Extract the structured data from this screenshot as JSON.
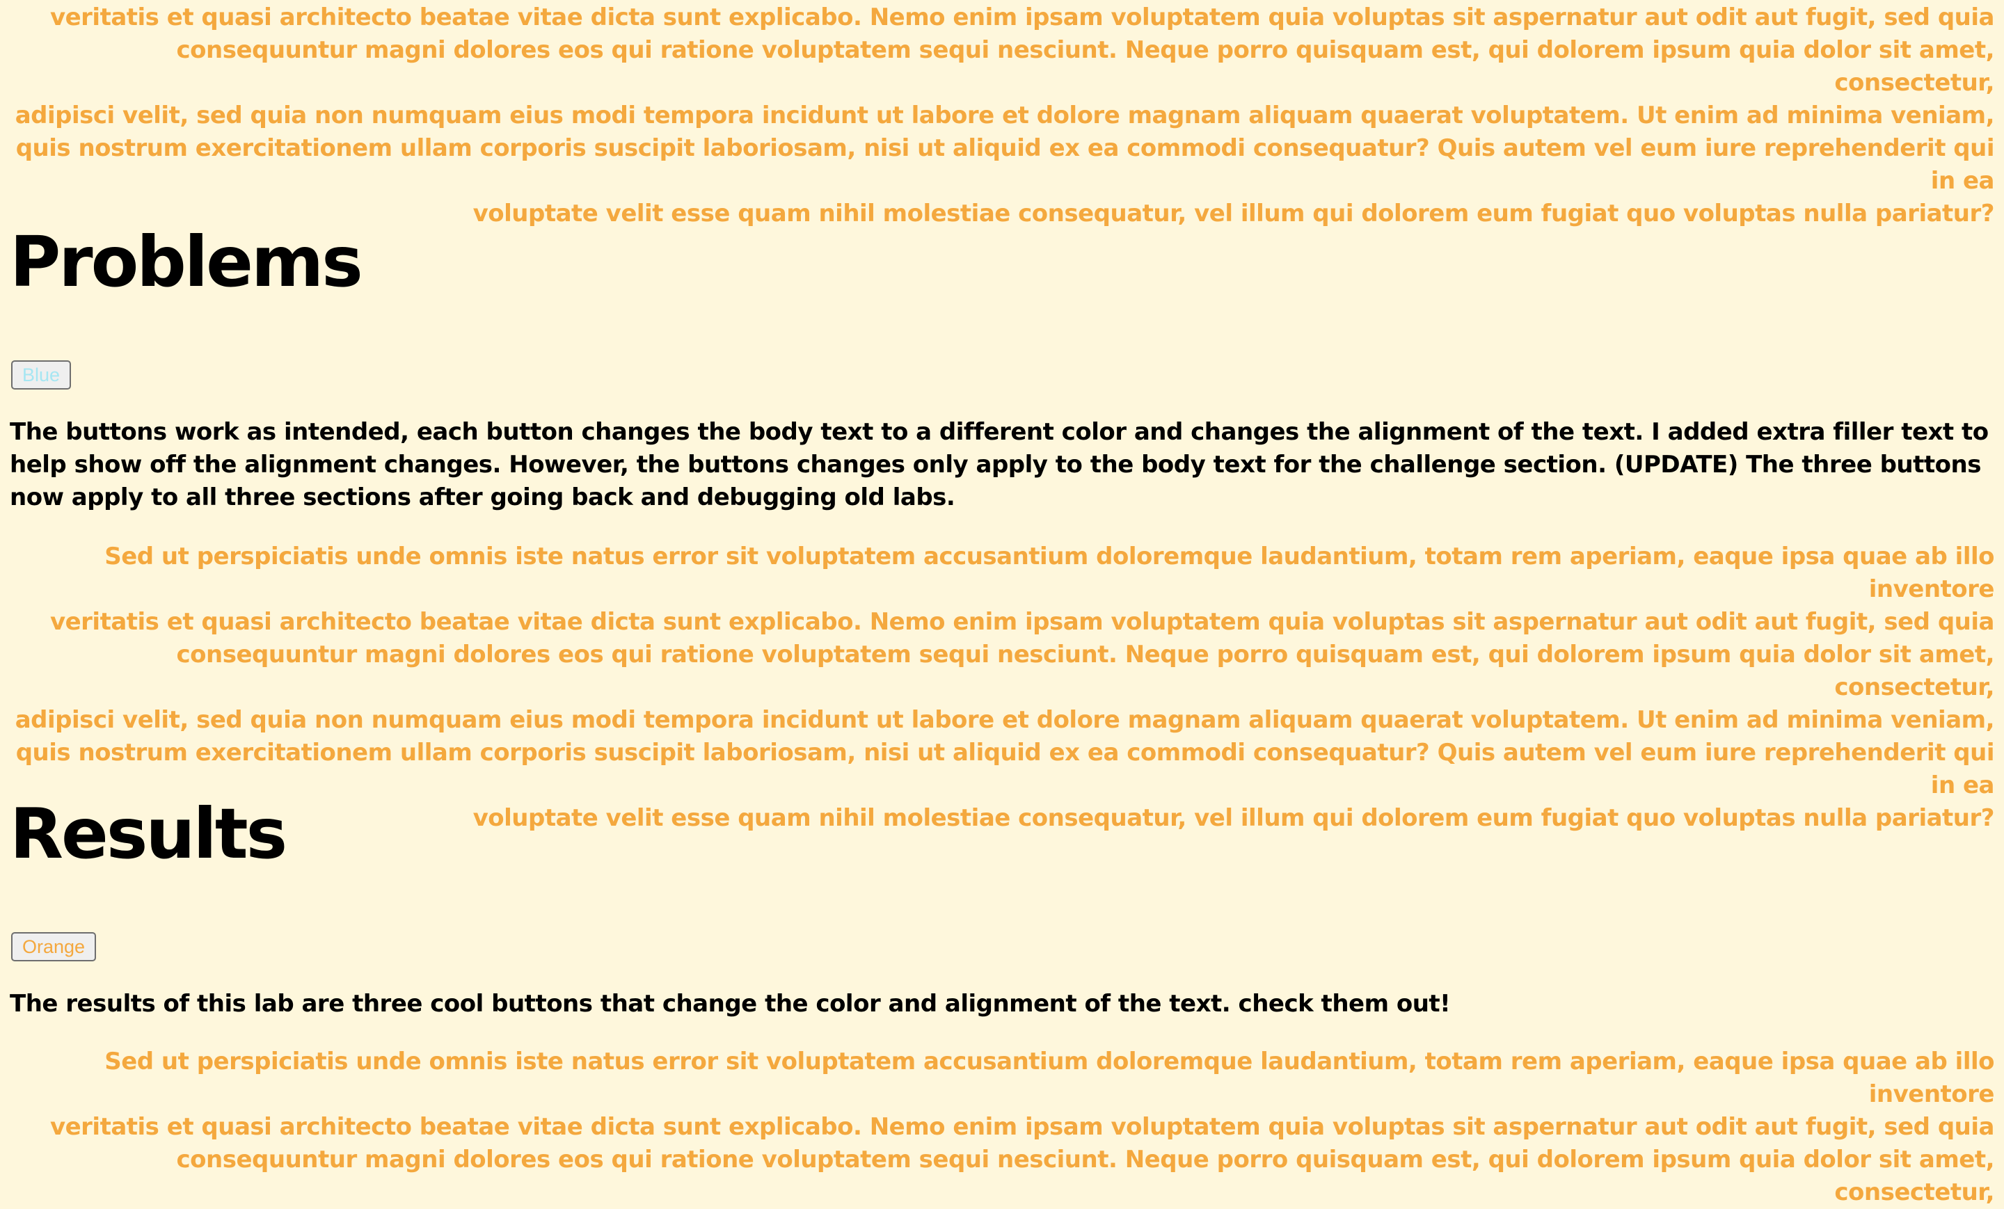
{
  "top_filler_lines": [
    "veritatis et quasi architecto beatae vitae dicta sunt explicabo. Nemo enim ipsam voluptatem quia voluptas sit aspernatur aut odit aut fugit, sed quia",
    "consequuntur magni dolores eos qui ratione voluptatem sequi nesciunt. Neque porro quisquam est, qui dolorem ipsum quia dolor sit amet, consectetur,",
    "adipisci velit, sed quia non numquam eius modi tempora incidunt ut labore et dolore magnam aliquam quaerat voluptatem. Ut enim ad minima veniam,",
    "quis nostrum exercitationem ullam corporis suscipit laboriosam, nisi ut aliquid ex ea commodi consequatur? Quis autem vel eum iure reprehenderit qui in ea",
    "voluptate velit esse quam nihil molestiae consequatur, vel illum qui dolorem eum fugiat quo voluptas nulla pariatur?"
  ],
  "problems": {
    "heading": "Problems",
    "button_label": "Blue",
    "body": "The buttons work as intended, each button changes the body text to a different color and changes the alignment of the text. I added extra filler text to help show off the alignment changes. However, the buttons changes only apply to the body text for the challenge section. (UPDATE) The three buttons now apply to all three sections after going back and debugging old labs.",
    "filler_lines": [
      "Sed ut perspiciatis unde omnis iste natus error sit voluptatem accusantium doloremque laudantium, totam rem aperiam, eaque ipsa quae ab illo inventore",
      "veritatis et quasi architecto beatae vitae dicta sunt explicabo. Nemo enim ipsam voluptatem quia voluptas sit aspernatur aut odit aut fugit, sed quia",
      "consequuntur magni dolores eos qui ratione voluptatem sequi nesciunt. Neque porro quisquam est, qui dolorem ipsum quia dolor sit amet, consectetur,",
      "adipisci velit, sed quia non numquam eius modi tempora incidunt ut labore et dolore magnam aliquam quaerat voluptatem. Ut enim ad minima veniam,",
      "quis nostrum exercitationem ullam corporis suscipit laboriosam, nisi ut aliquid ex ea commodi consequatur? Quis autem vel eum iure reprehenderit qui in ea",
      "voluptate velit esse quam nihil molestiae consequatur, vel illum qui dolorem eum fugiat quo voluptas nulla pariatur?"
    ]
  },
  "results": {
    "heading": "Results",
    "button_label": "Orange",
    "body": "The results of this lab are three cool buttons that change the color and alignment of the text. check them out!",
    "filler_lines": [
      "Sed ut perspiciatis unde omnis iste natus error sit voluptatem accusantium doloremque laudantium, totam rem aperiam, eaque ipsa quae ab illo inventore",
      "veritatis et quasi architecto beatae vitae dicta sunt explicabo. Nemo enim ipsam voluptatem quia voluptas sit aspernatur aut odit aut fugit, sed quia",
      "consequuntur magni dolores eos qui ratione voluptatem sequi nesciunt. Neque porro quisquam est, qui dolorem ipsum quia dolor sit amet, consectetur,"
    ]
  },
  "colors": {
    "background": "#fef7dc",
    "filler_text": "#f4a83e",
    "body_text": "#000000",
    "blue_button_text": "#a6e6f2",
    "orange_button_text": "#f4a83e"
  }
}
